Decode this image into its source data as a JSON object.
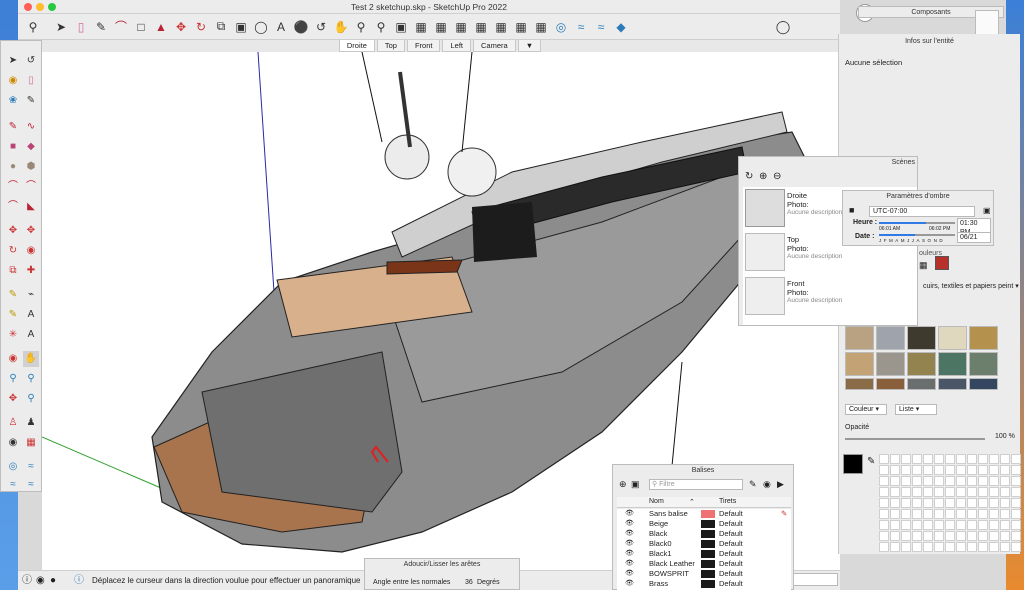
{
  "window": {
    "title": "Test 2 sketchup.skp - SketchUp Pro 2022"
  },
  "scene_tabs": [
    "Droite",
    "Top",
    "Front",
    "Left",
    "Camera"
  ],
  "scene_tabs_menu": "▼",
  "status": {
    "message": "Déplacez le curseur dans la direction voulue pour effectuer un panoramique",
    "label_under": "Angle entre les normales",
    "angle_value": "36",
    "angle_unit": "Degrés"
  },
  "adoucir": {
    "title": "Adoucir/Lisser les arêtes"
  },
  "composants": {
    "title": "Composants"
  },
  "entity_info": {
    "title": "Infos sur l'entité",
    "selection": "Aucune sélection"
  },
  "scenes_panel": {
    "title": "Scènes",
    "items": [
      {
        "name": "Droite",
        "photo": "Photo:",
        "desc": "Aucune description"
      },
      {
        "name": "Top",
        "photo": "Photo:",
        "desc": "Aucune description"
      },
      {
        "name": "Front",
        "photo": "Photo:",
        "desc": "Aucune description"
      }
    ]
  },
  "shadow": {
    "title": "Paramètres d'ombre",
    "utc": "UTC-07:00",
    "heure_label": "Heure :",
    "date_label": "Date :",
    "sunrise": "06:01 AM",
    "sunset": "06:02 PM",
    "time_value": "01:30 PM",
    "date_value": "06/21",
    "months": [
      "J",
      "F",
      "M",
      "A",
      "M",
      "J",
      "J",
      "A",
      "S",
      "O",
      "N",
      "D"
    ],
    "time_slider_fraction": 0.62,
    "date_slider_fraction": 0.47
  },
  "materials": {
    "tab_label": "ouleurs",
    "category": "cuirs, textiles et papiers peint",
    "swatch_colors": [
      "#b8a282",
      "#9fa4ac",
      "#3f3a2e",
      "#dfd8bf",
      "#b4924e",
      "#c3a275",
      "#9a968e",
      "#93844f",
      "#4c7663",
      "#6b7f6c",
      "#8a6b47",
      "#8a5f3b",
      "#6a6e6e",
      "#4a5668",
      "#344660"
    ],
    "mode_left": "Couleur",
    "mode_right": "Liste",
    "opacity_label": "Opacité",
    "opacity_value": "100 %",
    "current_color": "#000000"
  },
  "balises": {
    "title": "Balises",
    "filter_placeholder": "Filtre",
    "col_name": "Nom",
    "col_dash": "Tirets",
    "rows": [
      {
        "name": "Sans balise",
        "color": "#f07173",
        "dash": "Default"
      },
      {
        "name": "Beige",
        "color": "#1a1a1a",
        "dash": "Default"
      },
      {
        "name": "Black",
        "color": "#1a1a1a",
        "dash": "Default"
      },
      {
        "name": "Black0",
        "color": "#1a1a1a",
        "dash": "Default"
      },
      {
        "name": "Black1",
        "color": "#1a1a1a",
        "dash": "Default"
      },
      {
        "name": "Black Leather",
        "color": "#1a1a1a",
        "dash": "Default"
      },
      {
        "name": "BOWSPRIT",
        "color": "#1a1a1a",
        "dash": "Default"
      },
      {
        "name": "Brass",
        "color": "#1a1a1a",
        "dash": "Default"
      }
    ]
  }
}
